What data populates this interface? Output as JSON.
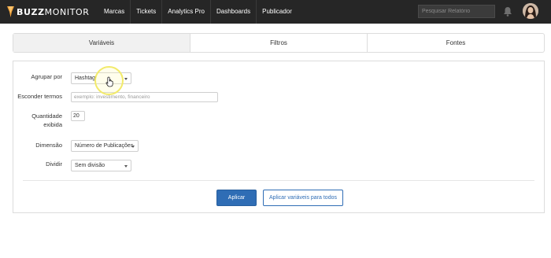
{
  "brand": {
    "strong": "BUZZ",
    "light": "MONITOR",
    "accent": "#f2a33a"
  },
  "nav": {
    "items": [
      "Marcas",
      "Tickets",
      "Analytics Pro",
      "Dashboards",
      "Publicador"
    ]
  },
  "search": {
    "placeholder": "Pesquisar Relatório"
  },
  "icons": {
    "bell": "bell-icon",
    "avatar": "user-avatar"
  },
  "tabs": [
    {
      "label": "Variáveis",
      "active": true
    },
    {
      "label": "Filtros",
      "active": false
    },
    {
      "label": "Fontes",
      "active": false
    }
  ],
  "form": {
    "group_by": {
      "label": "Agrupar por",
      "value": "Hashtag"
    },
    "hide_terms": {
      "label": "Esconder termos",
      "placeholder": "exemplo: investimento, financeiro"
    },
    "quantity": {
      "label_line1": "Quantidade",
      "label_line2": "exibida",
      "value": "20"
    },
    "dimension": {
      "label": "Dimensão",
      "value": "Número de Publicações"
    },
    "split": {
      "label": "Dividir",
      "value": "Sem divisão"
    }
  },
  "actions": {
    "apply": "Aplicar",
    "apply_all": "Aplicar variáveis para todos"
  },
  "colors": {
    "primary": "#2f6db5",
    "topbar": "#262626",
    "cursor_highlight": "#f2ea6a"
  }
}
